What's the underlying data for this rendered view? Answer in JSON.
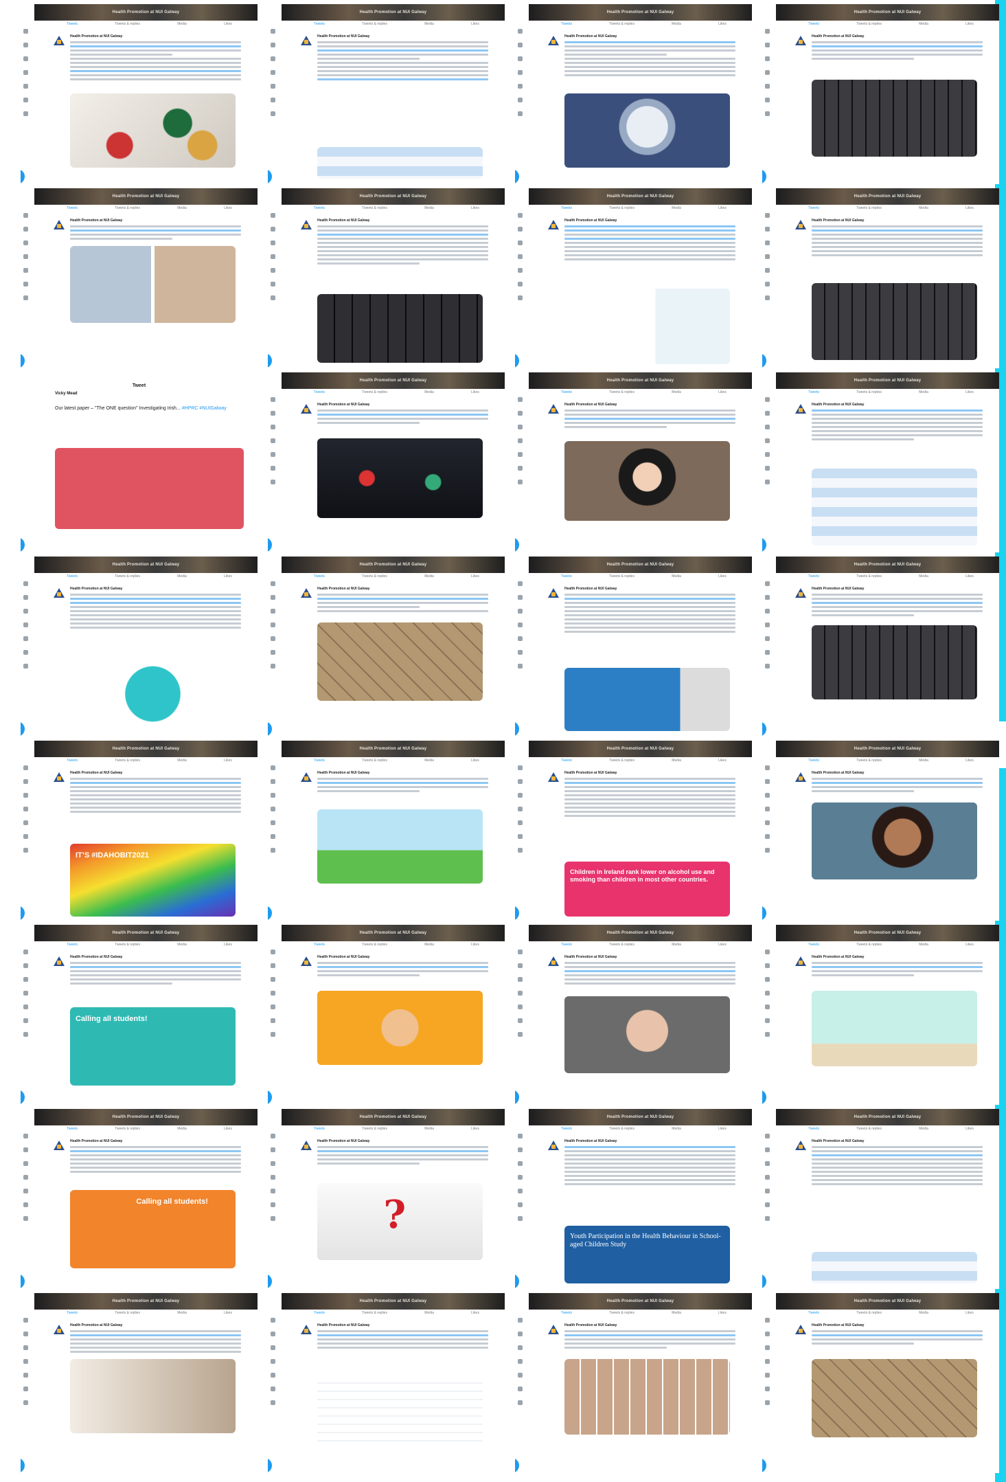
{
  "feed": {
    "header_title": "Health Promotion at NUI Galway",
    "tabs": [
      "Tweets",
      "Tweets & replies",
      "Media",
      "Likes"
    ],
    "account_name": "Health Promotion at NUI Galway"
  },
  "phone_tweet": {
    "screen_title": "Tweet",
    "author_name": "Vicky Mead",
    "body_text": "Our latest paper – \"The ONE question\" Investigating Irish...",
    "link_text": "#HPRC #NUIGalway"
  },
  "media_text": {
    "rainbow": "IT’S #IDAHOBIT2021",
    "alcohol": "Children in Ireland rank lower on alcohol use and smoking than children in most other countries.",
    "calling_students_1": "Calling all students!",
    "calling_students_2": "Calling all students!",
    "children_report": "Youth Participation in the Health Behaviour in School-aged Children Study"
  },
  "colors": {
    "accent_bar": "#19d3f0",
    "link_blue": "#1d9bf0"
  },
  "icons": {
    "compose": "compose-feather-icon",
    "avatar": "hprc-logo-icon"
  }
}
